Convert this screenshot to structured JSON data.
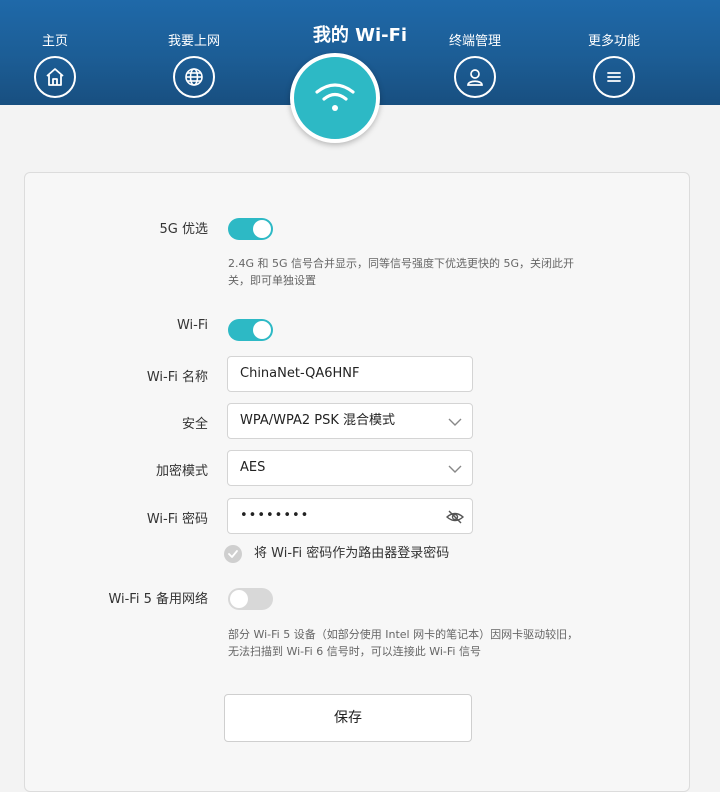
{
  "nav": {
    "home": "主页",
    "internet": "我要上网",
    "wifi": "我的 Wi-Fi",
    "devices": "终端管理",
    "more": "更多功能"
  },
  "settings": {
    "band5g_label": "5G 优选",
    "band5g_on": true,
    "band5g_hint": "2.4G 和 5G 信号合并显示，同等信号强度下优选更快的 5G，关闭此开关，即可单独设置",
    "wifi_label": "Wi-Fi",
    "wifi_on": true,
    "ssid_label": "Wi-Fi 名称",
    "ssid_value": "ChinaNet-QA6HNF",
    "security_label": "安全",
    "security_value": "WPA/WPA2 PSK 混合模式",
    "encryption_label": "加密模式",
    "encryption_value": "AES",
    "password_label": "Wi-Fi 密码",
    "password_value": "••••••••",
    "use_as_admin_label": "将 Wi-Fi 密码作为路由器登录密码",
    "wifi5_label": "Wi-Fi 5 备用网络",
    "wifi5_on": false,
    "wifi5_hint": "部分 Wi-Fi 5 设备（如部分使用 Intel 网卡的笔记本）因网卡驱动较旧，无法扫描到 Wi-Fi 6 信号时，可以连接此 Wi-Fi 信号",
    "save_label": "保存"
  },
  "colors": {
    "header": "#1c5d95",
    "accent": "#2db9c5",
    "toggle_off": "#d8d8d8"
  }
}
